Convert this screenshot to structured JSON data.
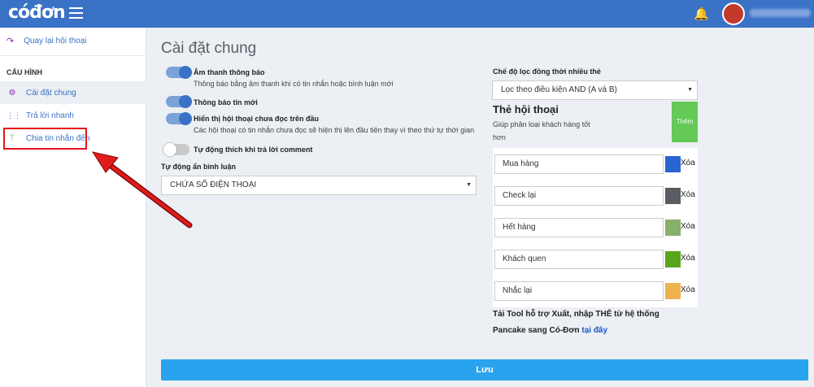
{
  "header": {
    "logo": "cóđơn"
  },
  "sidebar": {
    "back_label": "Quay lại hội thoại",
    "section_label": "CẤU HÌNH",
    "items": [
      {
        "label": "Cài đặt chung",
        "icon": "gear-icon",
        "active": true
      },
      {
        "label": "Trả lời nhanh",
        "icon": "dots-grid-icon",
        "active": false
      },
      {
        "label": "Chia tin nhắn đến",
        "icon": "split-arrow-icon",
        "active": false
      }
    ]
  },
  "page": {
    "title": "Cài đặt chung"
  },
  "settings": {
    "sound": {
      "label": "Âm thanh thông báo",
      "desc": "Thông báo bằng âm thanh khi có tin nhắn hoặc bình luận mới",
      "enabled": true
    },
    "new_msg": {
      "label": "Thông báo tin mới",
      "enabled": true
    },
    "unread_top": {
      "label": "Hiển thị hội thoại chưa đọc trên đầu",
      "desc": "Các hội thoại có tin nhắn chưa đọc sẽ hiện thị lên đầu tiên thay vì theo thứ tự thời gian",
      "enabled": true
    },
    "auto_like": {
      "label": "Tự động thích khi trả lời comment",
      "enabled": false
    },
    "auto_hide": {
      "label": "Tự động ẩn bình luận",
      "value": "CHỨA SỐ ĐIỆN THOẠI"
    }
  },
  "filter": {
    "label": "Chế độ lọc đồng thời nhiều thẻ",
    "value": "Lọc theo điều kiện AND (A và B)"
  },
  "tags": {
    "title": "Thẻ hội thoại",
    "help_line1": "Giúp phân loại khách hàng tốt",
    "help_line2": "hơn",
    "add_label": "Thêm",
    "delete_label": "Xóa",
    "items": [
      {
        "name": "Mua hàng",
        "color": "#2a64d1"
      },
      {
        "name": "Check lại",
        "color": "#5a5d61"
      },
      {
        "name": "Hết hàng",
        "color": "#88b06a"
      },
      {
        "name": "Khách quen",
        "color": "#5aa51d"
      },
      {
        "name": "Nhắc lại",
        "color": "#eeb24e"
      }
    ]
  },
  "tool_note": {
    "line1": "Tải Tool hỗ trợ Xuất, nhập THẺ từ hệ thống",
    "line2_prefix": "Pancake sang Có-Đơn",
    "link": "tại đây"
  },
  "save_label": "Lưu"
}
